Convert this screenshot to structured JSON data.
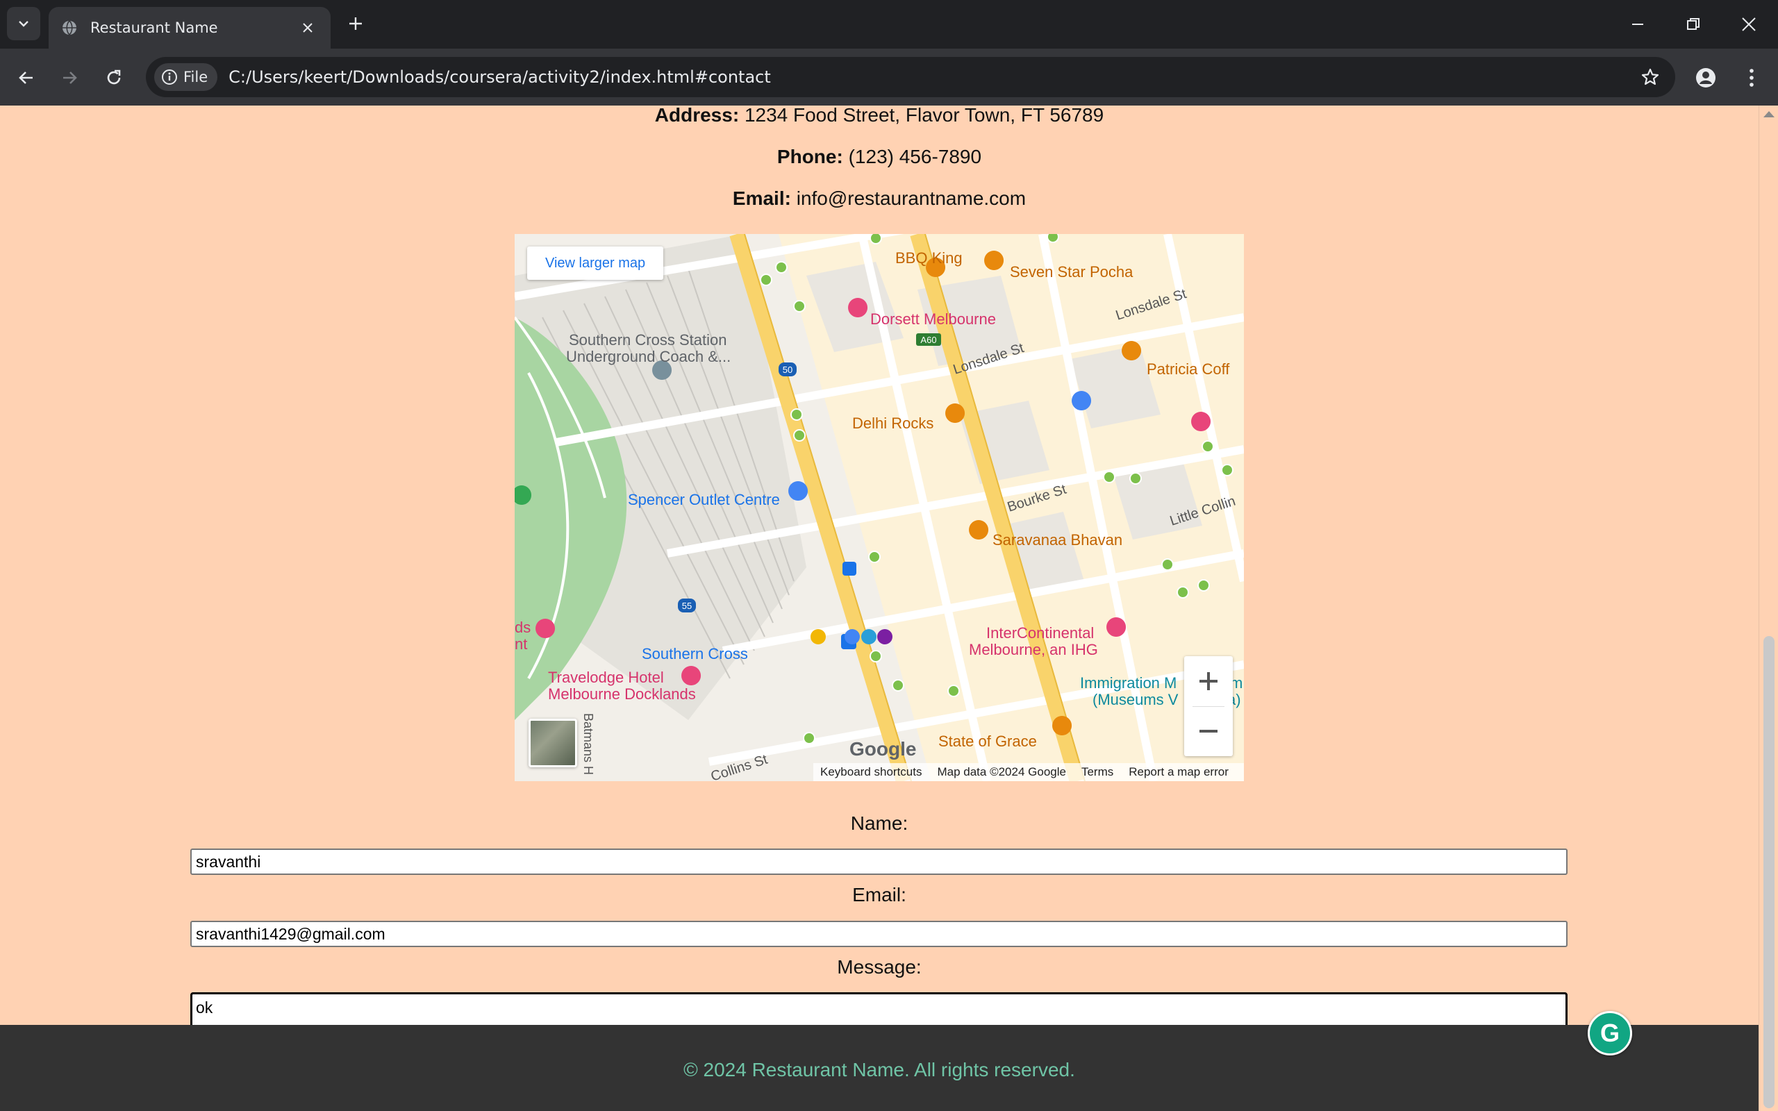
{
  "browser": {
    "tab_title": "Restaurant Name",
    "url": "C:/Users/keert/Downloads/coursera/activity2/index.html#contact",
    "site_info_label": "File"
  },
  "contact": {
    "address_label": "Address:",
    "address_value": "1234 Food Street, Flavor Town, FT 56789",
    "phone_label": "Phone:",
    "phone_value": "(123) 456-7890",
    "email_label": "Email:",
    "email_value": "info@restaurantname.com"
  },
  "map": {
    "view_larger": "View larger map",
    "google": "Google",
    "footer": {
      "shortcuts": "Keyboard shortcuts",
      "data": "Map data ©2024 Google",
      "terms": "Terms",
      "report": "Report a map error"
    },
    "labels": {
      "bbq_king": "BBQ King",
      "seven_star": "Seven Star Pocha",
      "lonsdale_1": "Lonsdale St",
      "lonsdale_2": "Lonsdale St",
      "dorsett": "Dorsett Melbourne",
      "a60": "A60",
      "southern_cross_station_1": "Southern Cross Station",
      "southern_cross_station_2": "Underground Coach &...",
      "r50": "50",
      "patricia": "Patricia Coff",
      "delhi_rocks": "Delhi Rocks",
      "spencer": "Spencer Outlet Centre",
      "bourke": "Bourke St",
      "little_collins": "Little Collin",
      "saravanaa": "Saravanaa Bhavan",
      "r55": "55",
      "ds_1": "ds",
      "ds_2": "nt",
      "intercontinental_1": "InterContinental",
      "intercontinental_2": "Melbourne, an IHG",
      "southern_cross": "Southern Cross",
      "travelodge_1": "Travelodge Hotel",
      "travelodge_2": "Melbourne Docklands",
      "immigration_1": "Immigration M",
      "immigration_2": "(Museums V",
      "immigration_3": "m",
      "immigration_4": "a)",
      "state_of_grace": "State of Grace",
      "batmans": "Batmans H",
      "collins": "Collins St"
    }
  },
  "form": {
    "name_label": "Name:",
    "name_value": "sravanthi",
    "email_label": "Email:",
    "email_value": "sravanthi1429@gmail.com",
    "message_label": "Message:",
    "message_value": "ok"
  },
  "footer": {
    "text": "© 2024 Restaurant Name. All rights reserved."
  },
  "colors": {
    "page_bg": "#ffd2b3",
    "footer_bg": "#333333",
    "footer_text": "#6fc4a6",
    "map_road_major": "#f9d36b",
    "map_park": "#a8d5a2",
    "map_poi_orange": "#e8890c",
    "map_poi_pink": "#e8457a",
    "map_link_blue": "#1a73e8"
  }
}
